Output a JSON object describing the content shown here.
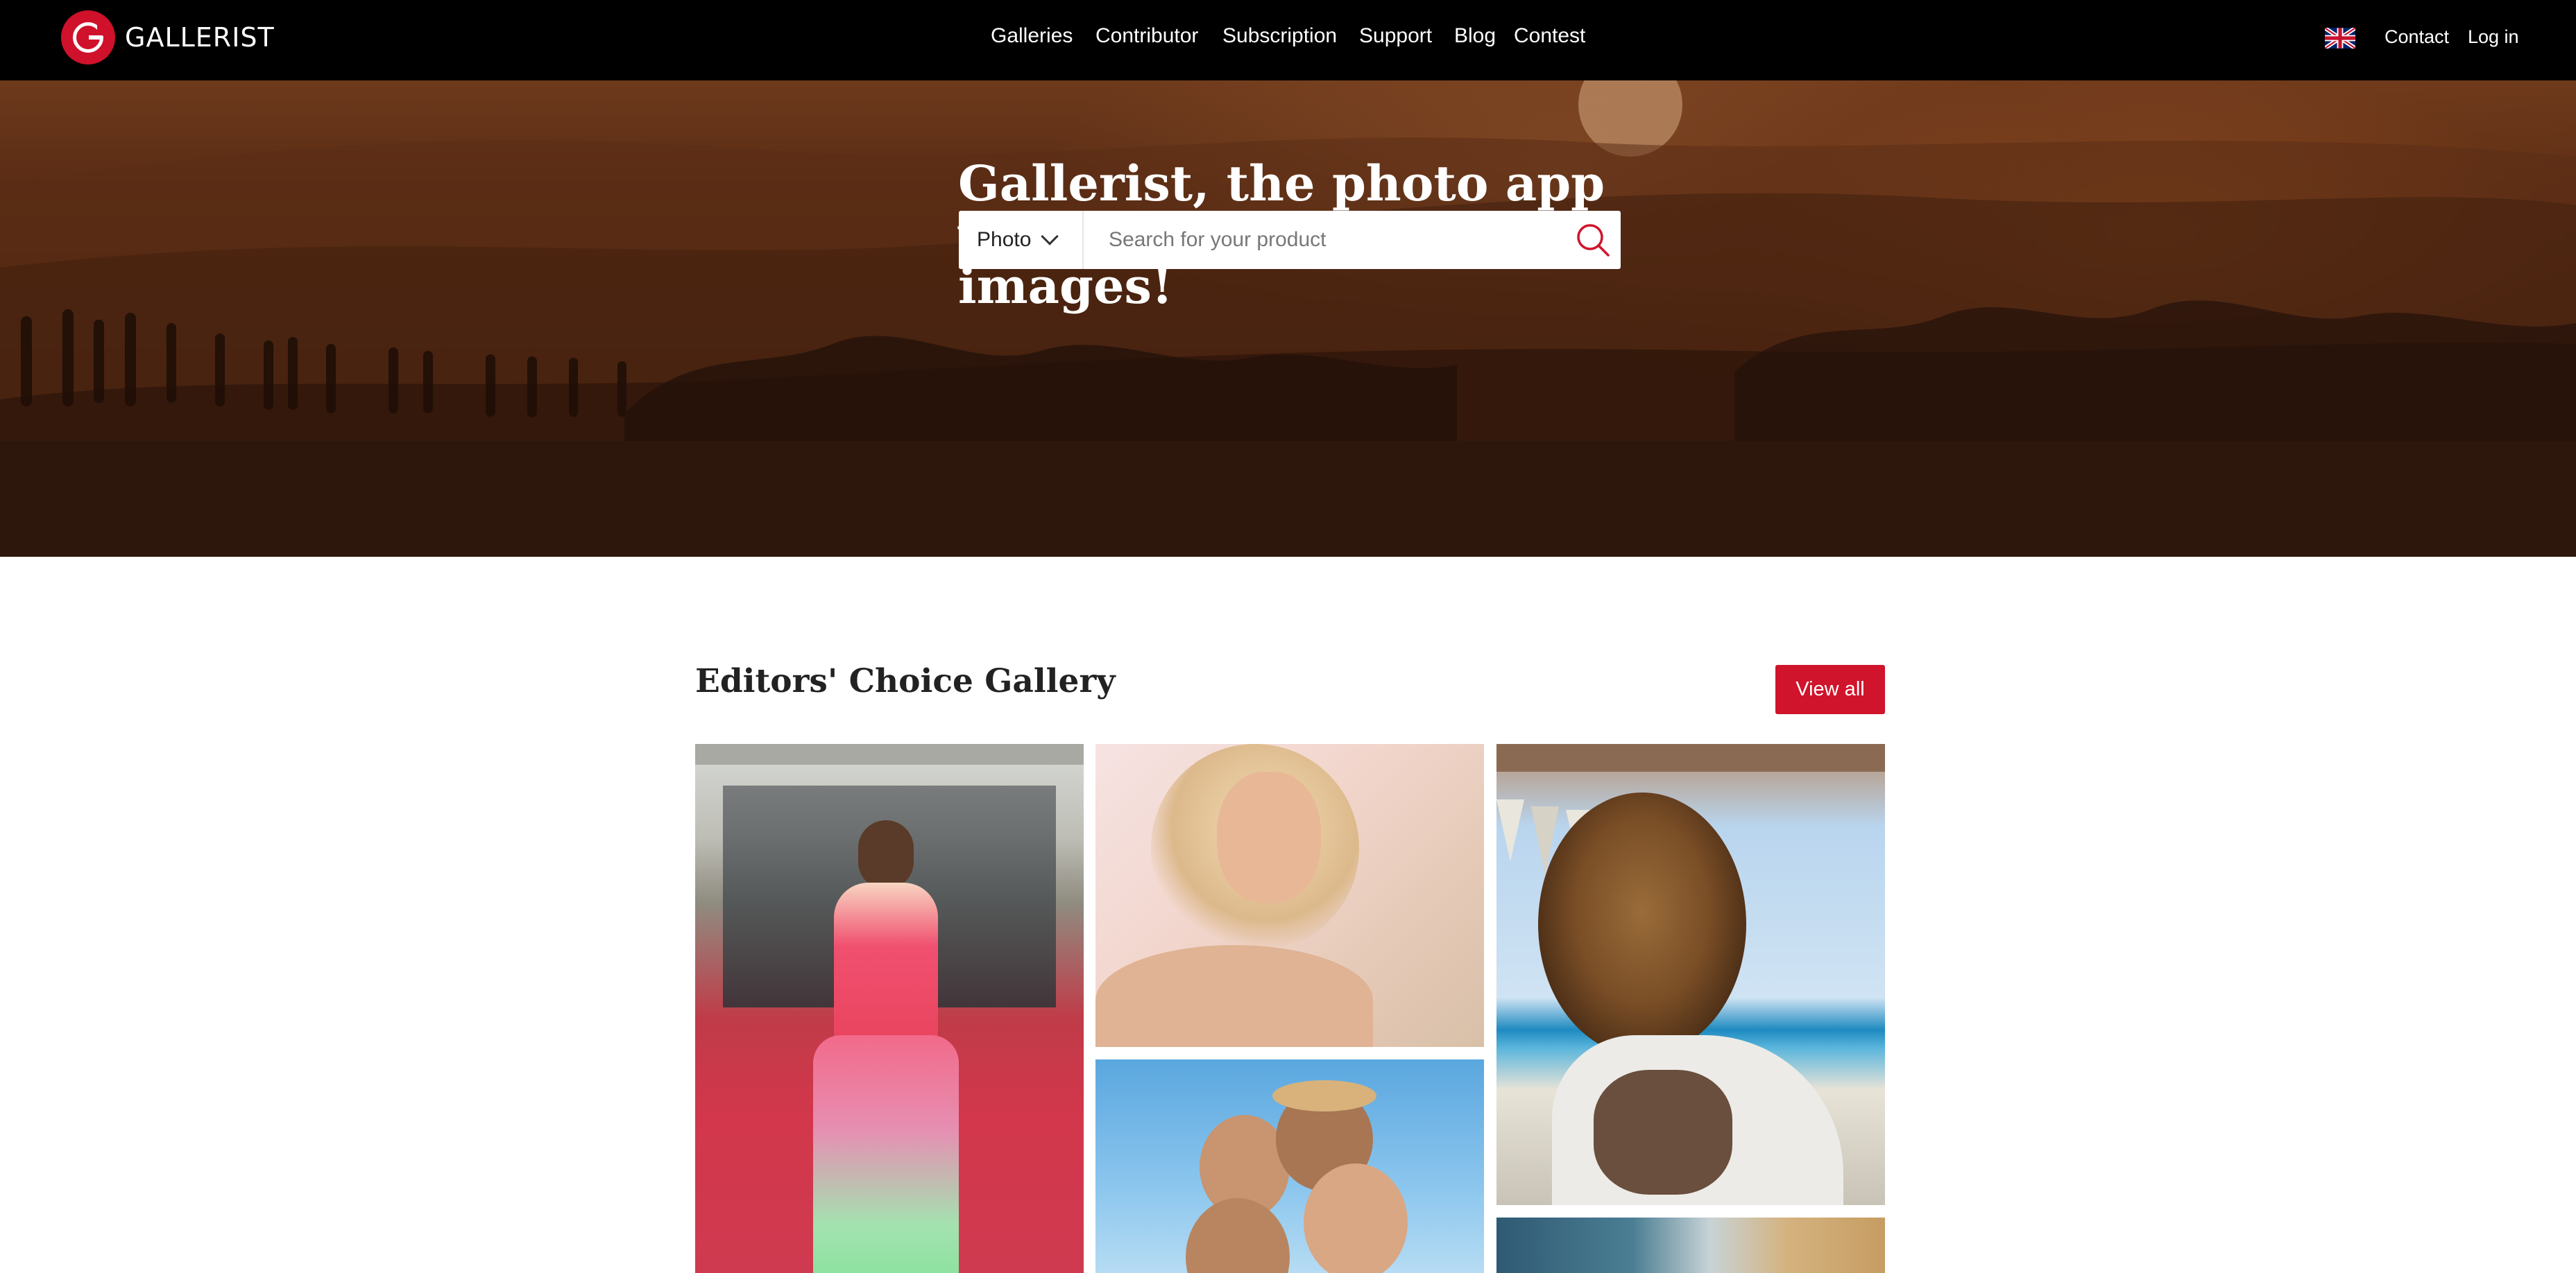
{
  "brand": {
    "name": "GALLERIST",
    "accent": "#d0112b"
  },
  "nav": {
    "links": [
      "Galleries",
      "Contributor",
      "Subscription",
      "Support",
      "Blog",
      "Contest"
    ],
    "language_icon": "uk-flag-icon",
    "contact": "Contact",
    "login": "Log in"
  },
  "hero": {
    "title": "Gallerist, the photo app which values your images!",
    "search": {
      "type": "Photo",
      "placeholder": "Search for your product",
      "icon": "search-icon"
    }
  },
  "gallery": {
    "title": "Editors' Choice Gallery",
    "view_all": "View all",
    "button_color": "#cf142b"
  }
}
